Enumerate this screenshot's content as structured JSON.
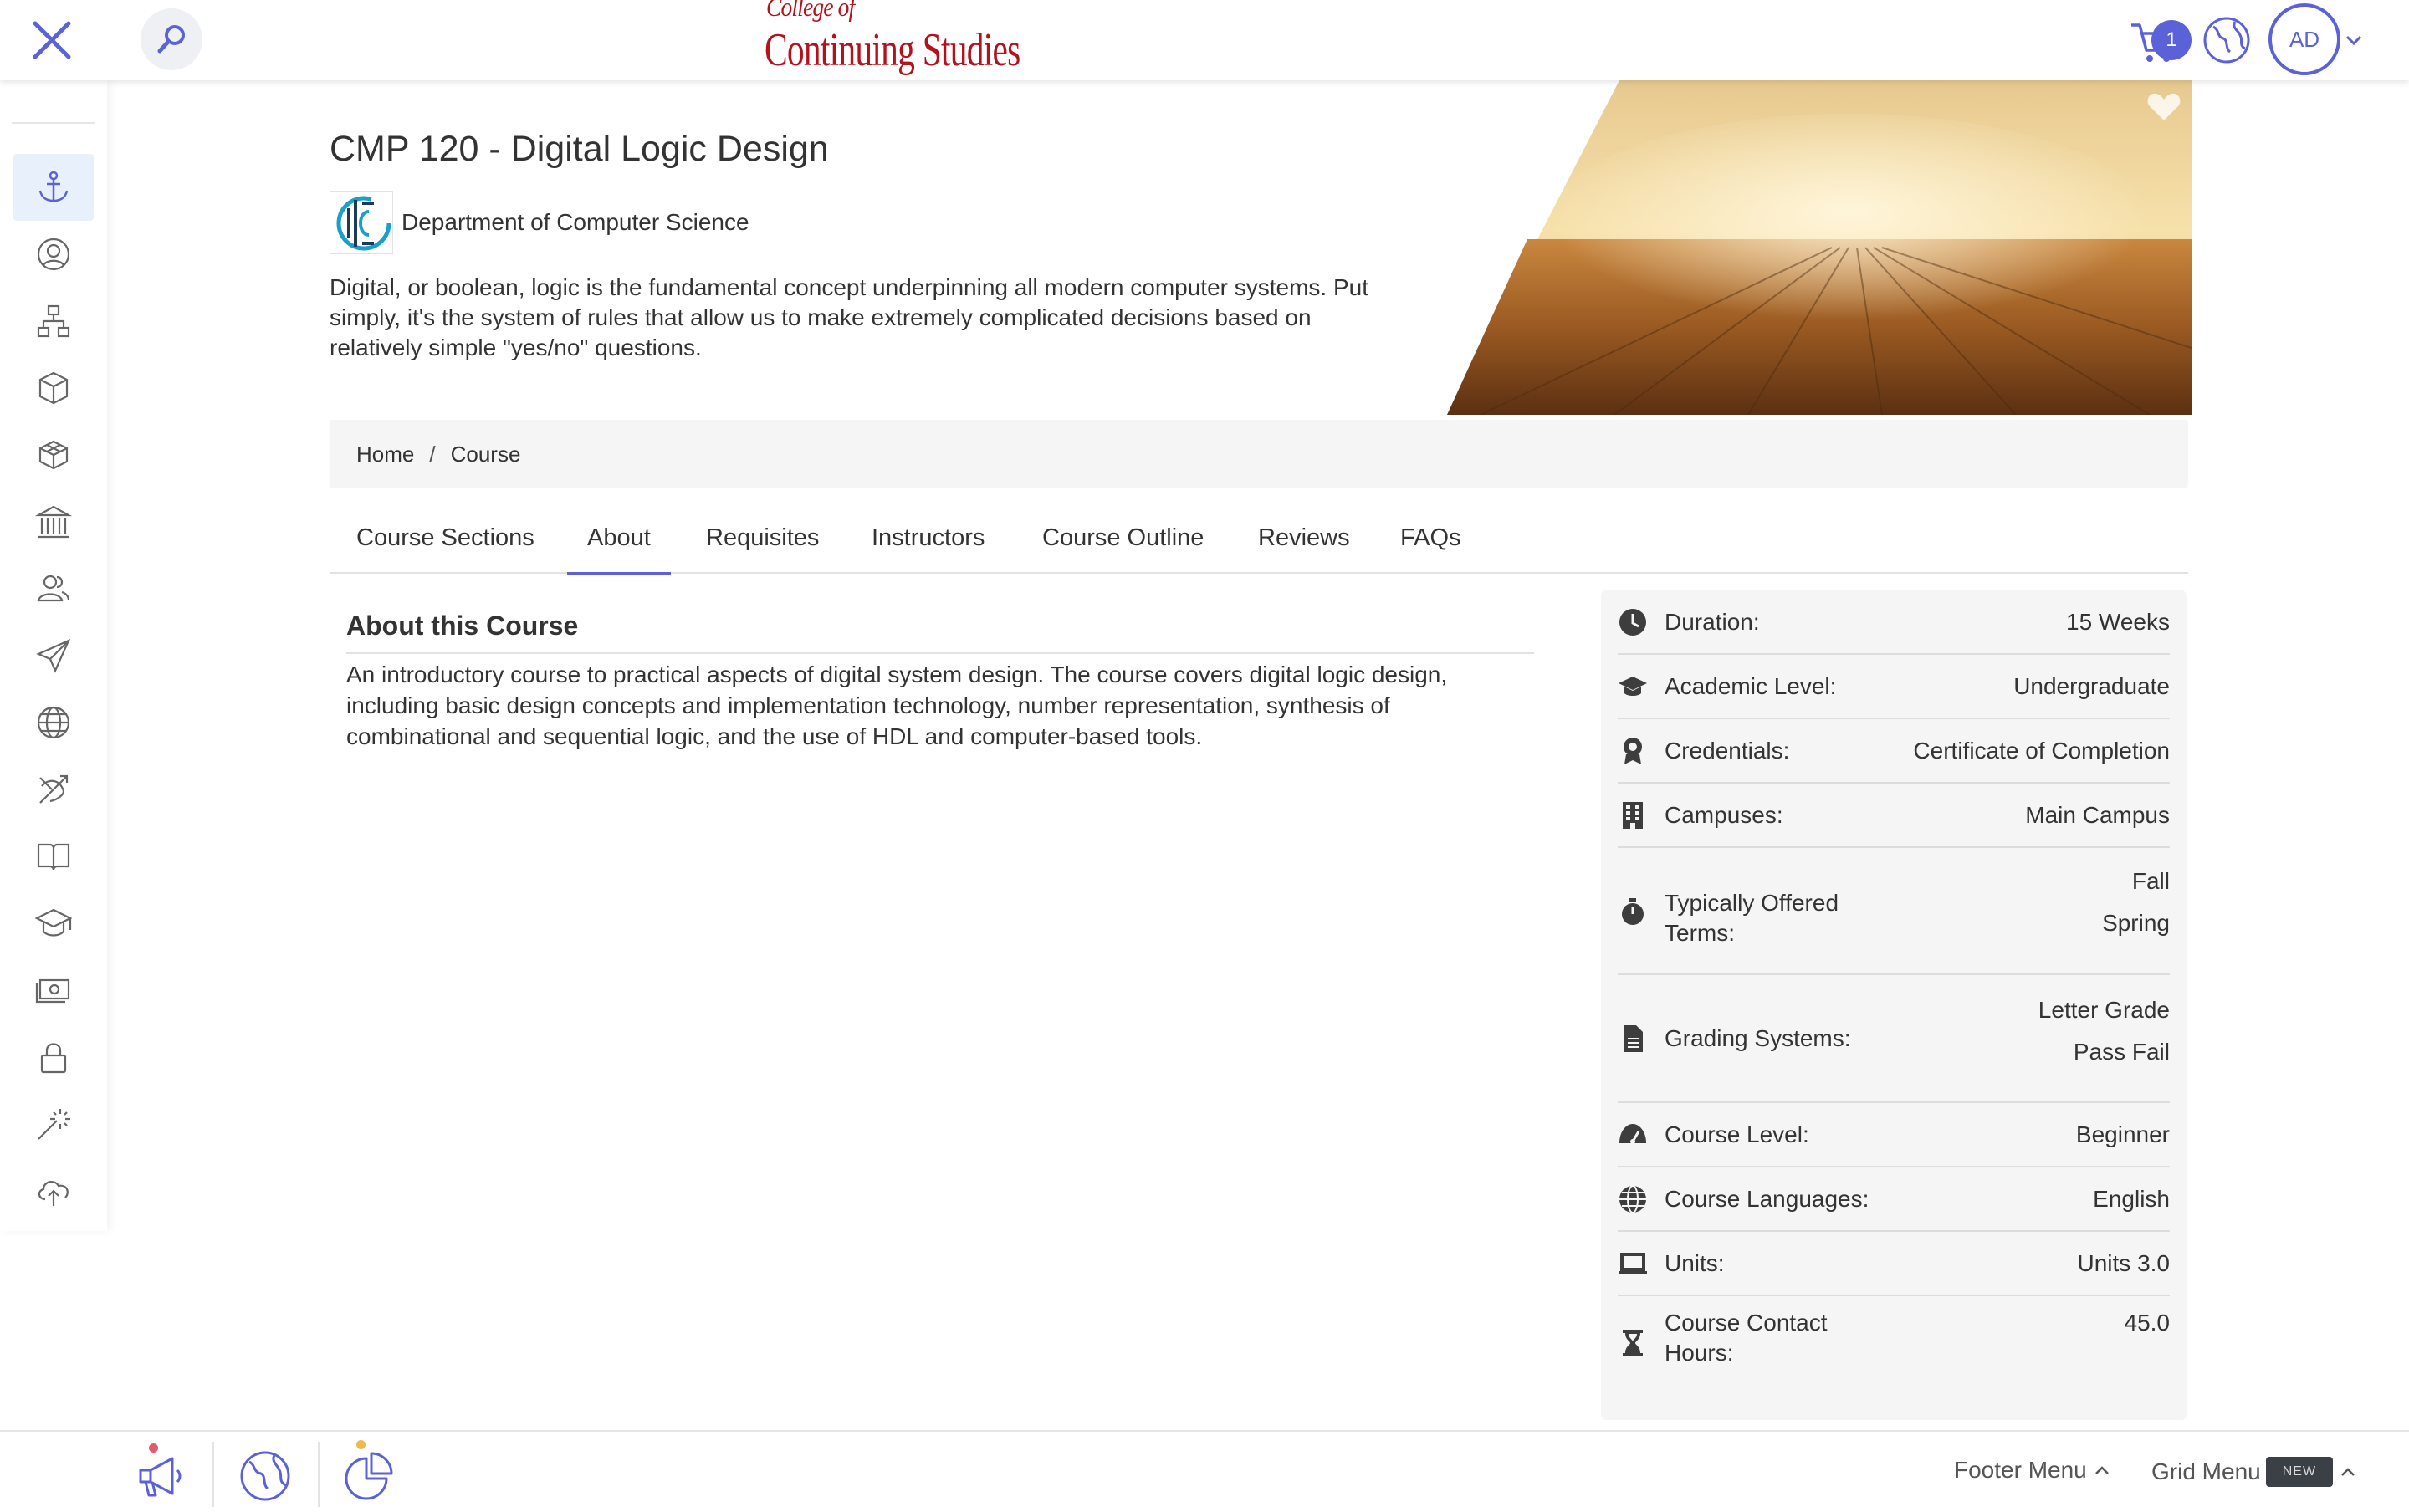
{
  "colors": {
    "accent": "#5b62d8",
    "brand_red": "#b3121d",
    "sidebar_active_bg": "#e8f1fb",
    "card_bg": "#f5f5f5"
  },
  "header": {
    "logo_line1": "College of",
    "logo_line2": "Continuing Studies",
    "cart_count": "1",
    "avatar_initials": "AD",
    "icons": [
      "close-icon",
      "search-icon",
      "cart-icon",
      "globe-icon",
      "chevron-down-icon"
    ]
  },
  "sidebar": {
    "items": [
      {
        "icon": "anchor-icon",
        "active": true
      },
      {
        "icon": "user-circle-icon"
      },
      {
        "icon": "org-chart-icon"
      },
      {
        "icon": "cube-icon"
      },
      {
        "icon": "cubes-icon"
      },
      {
        "icon": "institution-icon"
      },
      {
        "icon": "people-icon"
      },
      {
        "icon": "paper-plane-icon"
      },
      {
        "icon": "globe-icon"
      },
      {
        "icon": "target-arrow-icon"
      },
      {
        "icon": "book-icon"
      },
      {
        "icon": "graduation-cap-icon"
      },
      {
        "icon": "money-icon"
      },
      {
        "icon": "lock-icon"
      },
      {
        "icon": "magic-wand-icon"
      },
      {
        "icon": "cloud-upload-icon"
      }
    ]
  },
  "course": {
    "title": "CMP 120 - Digital Logic Design",
    "department": "Department of Computer Science",
    "description": "Digital, or boolean, logic is the fundamental concept underpinning all modern computer systems. Put simply, it's the system of rules that allow us to make extremely complicated decisions based on relatively simple \"yes/no\" questions."
  },
  "breadcrumb": {
    "home": "Home",
    "separator": "/",
    "current": "Course"
  },
  "tabs": [
    {
      "label": "Course Sections"
    },
    {
      "label": "About",
      "active": true
    },
    {
      "label": "Requisites"
    },
    {
      "label": "Instructors"
    },
    {
      "label": "Course Outline"
    },
    {
      "label": "Reviews"
    },
    {
      "label": "FAQs"
    }
  ],
  "about": {
    "heading": "About this Course",
    "text": "An introductory course to practical aspects of digital system design. The course covers digital logic design, including basic design concepts and implementation technology, number representation, synthesis of combinational and sequential logic, and the use of HDL and computer-based tools."
  },
  "details": [
    {
      "icon": "clock-icon",
      "label": "Duration:",
      "values": [
        "15 Weeks"
      ]
    },
    {
      "icon": "graduation-cap-icon",
      "label": "Academic Level:",
      "values": [
        "Undergraduate"
      ]
    },
    {
      "icon": "award-icon",
      "label": "Credentials:",
      "values": [
        "Certificate of Completion"
      ]
    },
    {
      "icon": "building-icon",
      "label": "Campuses:",
      "values": [
        "Main Campus"
      ]
    },
    {
      "icon": "stopwatch-icon",
      "label": "Typically Offered Terms:",
      "values": [
        "Fall",
        "Spring"
      ]
    },
    {
      "icon": "file-icon",
      "label": "Grading Systems:",
      "values": [
        "Letter Grade",
        "Pass Fail"
      ]
    },
    {
      "icon": "gauge-icon",
      "label": "Course Level:",
      "values": [
        "Beginner"
      ]
    },
    {
      "icon": "globe-icon",
      "label": "Course Languages:",
      "values": [
        "English"
      ]
    },
    {
      "icon": "laptop-icon",
      "label": "Units:",
      "values": [
        "Units 3.0"
      ]
    },
    {
      "icon": "hourglass-icon",
      "label": "Course Contact Hours:",
      "values": [
        "45.0"
      ]
    }
  ],
  "footer": {
    "icons": [
      "megaphone-icon",
      "globe-icon",
      "pie-chart-icon"
    ],
    "footer_menu": "Footer Menu",
    "grid_menu": "Grid Menu",
    "new_badge": "NEW"
  }
}
